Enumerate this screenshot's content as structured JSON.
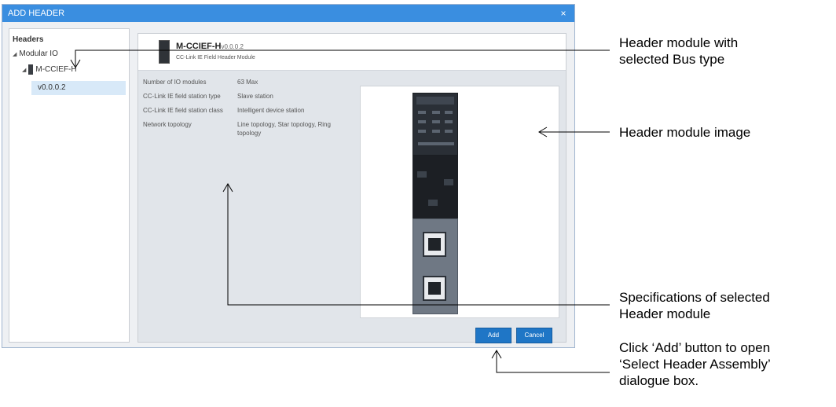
{
  "dialog": {
    "title": "ADD HEADER",
    "close_glyph": "×"
  },
  "tree": {
    "heading": "Headers",
    "root_label": "Modular IO",
    "module_label": "M-CCIEF-H",
    "version_label": "v0.0.0.2"
  },
  "module": {
    "name": "M-CCIEF-H",
    "version": "v0.0.0.2",
    "description": "CC-Link IE Field Header Module"
  },
  "specs": [
    {
      "key": "Number of IO modules",
      "value": "63 Max"
    },
    {
      "key": "CC-Link IE field station type",
      "value": "Slave station"
    },
    {
      "key": "CC-Link IE field station class",
      "value": "Intelligent device station"
    },
    {
      "key": "Network topology",
      "value": "Line topology, Star topology, Ring topology"
    }
  ],
  "buttons": {
    "add": "Add",
    "cancel": "Cancel"
  },
  "annotations": {
    "header_module_line1": "Header module with",
    "header_module_line2": "selected Bus type",
    "image": "Header module image",
    "specs_line1": "Specifications of selected",
    "specs_line2": "Header module",
    "add_line1": "Click ‘Add’ button to open",
    "add_line2": "‘Select Header Assembly’",
    "add_line3": "dialogue box."
  },
  "colors": {
    "titlebar": "#3a8ee0",
    "button": "#1f76c6",
    "selection": "#d8e9f8"
  }
}
